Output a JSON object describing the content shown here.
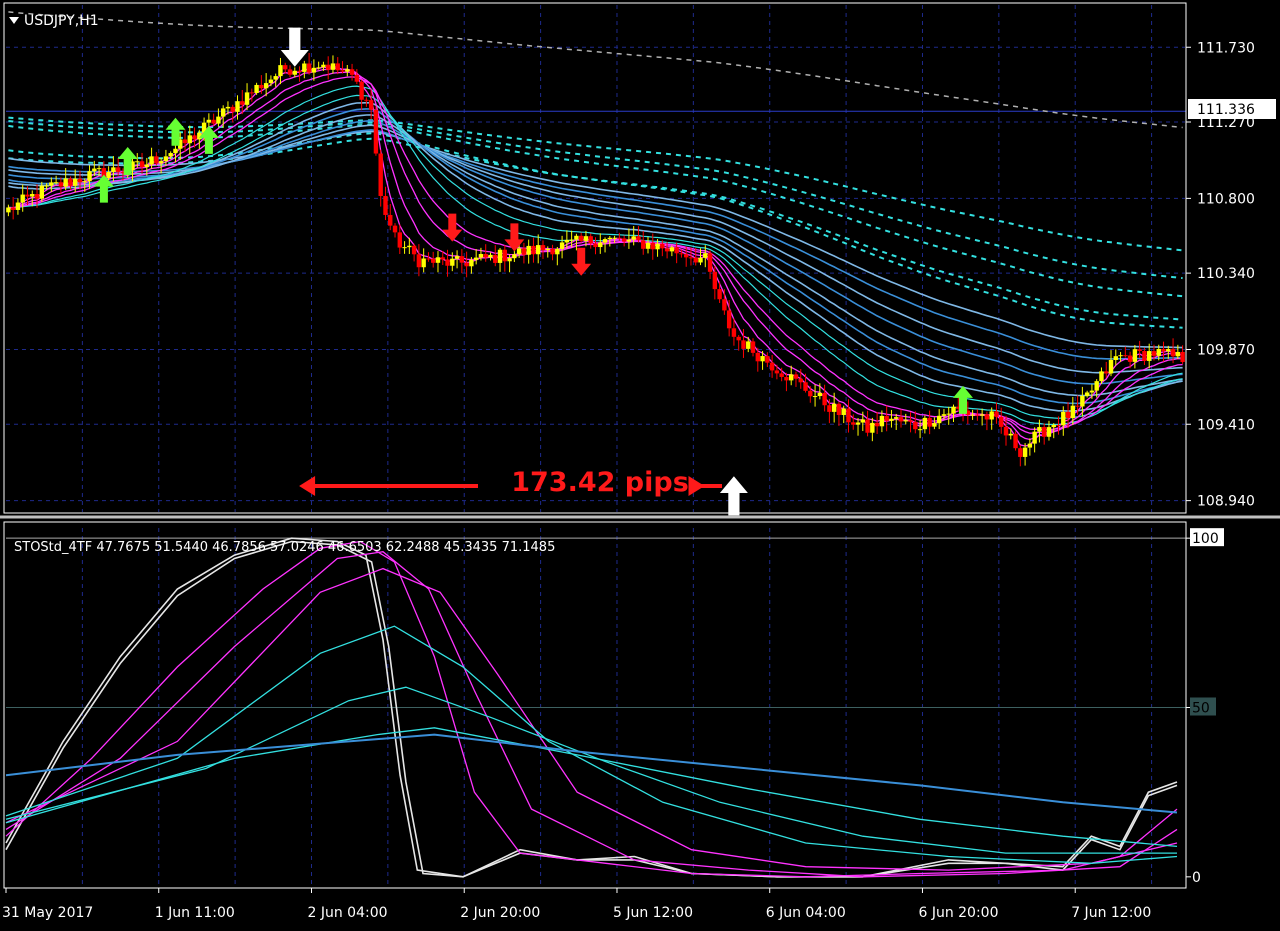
{
  "window": {
    "title": "USDJPY,H1"
  },
  "price_panel": {
    "current_price_label": "111.336",
    "annotation": {
      "text": "173.42  pips"
    }
  },
  "indicator_panel": {
    "label": "STOStd_4TF 47.7675 51.5440 46.7856 57.0246 46.6503 62.2488 45.3435 71.1485"
  },
  "colors": {
    "background": "#000000",
    "bull_candle": "#ffff00",
    "bear_candle": "#ff0000",
    "grid": "#1e2a8c",
    "axis": "#ffffff",
    "magenta_ma": "#ff33ff",
    "cyan_ma": "#33e0e0",
    "blue_ma": "#3a8fd8",
    "stoch_white": "#e6e6e6",
    "arrow_up": "#66ff33",
    "arrow_down": "#ff1a1a",
    "annotation": "#ff1a1a"
  },
  "chart_data": [
    {
      "type": "candlestick",
      "symbol": "USDJPY",
      "timeframe": "H1",
      "title": "USDJPY,H1",
      "y_ticks": [
        111.73,
        111.27,
        110.8,
        110.34,
        109.87,
        109.41,
        108.94
      ],
      "y_tick_labels": [
        "111.730",
        "111.270",
        "110.800",
        "110.340",
        "109.870",
        "109.410",
        "108.940"
      ],
      "ylim": [
        108.87,
        111.99
      ],
      "current_price": 111.336,
      "grid": true,
      "x_tick_labels": [
        "31 May 2017",
        "1 Jun 11:00",
        "2 Jun 04:00",
        "2 Jun 20:00",
        "5 Jun 12:00",
        "6 Jun 04:00",
        "6 Jun 20:00",
        "7 Jun 12:00"
      ],
      "close_path": [
        [
          0,
          110.73
        ],
        [
          8,
          110.86
        ],
        [
          18,
          110.95
        ],
        [
          28,
          111.0
        ],
        [
          36,
          111.12
        ],
        [
          44,
          111.3
        ],
        [
          52,
          111.48
        ],
        [
          58,
          111.6
        ],
        [
          66,
          111.63
        ],
        [
          72,
          111.55
        ],
        [
          76,
          111.35
        ],
        [
          78,
          110.8
        ],
        [
          81,
          110.55
        ],
        [
          86,
          110.42
        ],
        [
          94,
          110.4
        ],
        [
          104,
          110.45
        ],
        [
          114,
          110.5
        ],
        [
          124,
          110.55
        ],
        [
          134,
          110.52
        ],
        [
          142,
          110.46
        ],
        [
          146,
          110.42
        ],
        [
          149,
          110.15
        ],
        [
          152,
          109.95
        ],
        [
          158,
          109.82
        ],
        [
          166,
          109.65
        ],
        [
          174,
          109.48
        ],
        [
          180,
          109.38
        ],
        [
          184,
          109.45
        ],
        [
          190,
          109.4
        ],
        [
          198,
          109.5
        ],
        [
          206,
          109.45
        ],
        [
          212,
          109.25
        ],
        [
          218,
          109.4
        ],
        [
          224,
          109.5
        ],
        [
          232,
          109.82
        ],
        [
          240,
          109.85
        ],
        [
          245,
          109.82
        ]
      ],
      "signals": [
        {
          "type": "buy",
          "color": "green",
          "bar": 20,
          "price": 110.86
        },
        {
          "type": "buy",
          "color": "green",
          "bar": 25,
          "price": 111.03
        },
        {
          "type": "buy",
          "color": "green",
          "bar": 35,
          "price": 111.21
        },
        {
          "type": "buy",
          "color": "green",
          "bar": 42,
          "price": 111.16
        },
        {
          "type": "sell",
          "color": "white",
          "bar": 60,
          "price": 111.73
        },
        {
          "type": "sell",
          "color": "red",
          "bar": 93,
          "price": 110.62
        },
        {
          "type": "sell",
          "color": "red",
          "bar": 106,
          "price": 110.56
        },
        {
          "type": "sell",
          "color": "red",
          "bar": 120,
          "price": 110.41
        },
        {
          "type": "buy",
          "color": "white",
          "bar": 152,
          "price": 108.97
        },
        {
          "type": "buy",
          "color": "green",
          "bar": 200,
          "price": 109.56
        }
      ],
      "annotation": {
        "text": "173.42  pips",
        "from_bar": 63,
        "to_bar": 145,
        "price": 109.03
      }
    },
    {
      "type": "line",
      "title": "STOStd_4TF",
      "values_label": [
        47.7675,
        51.544,
        46.7856,
        57.0246,
        46.6503,
        62.2488,
        45.3435,
        71.1485
      ],
      "ylim": [
        -3,
        103
      ],
      "y_ticks": [
        100,
        50,
        0
      ],
      "y_tick_labels": [
        "100",
        "50",
        "0"
      ],
      "levels": [
        100,
        50
      ],
      "series": [
        {
          "color": "white",
          "points": [
            [
              0,
              10
            ],
            [
              10,
              40
            ],
            [
              20,
              65
            ],
            [
              30,
              85
            ],
            [
              40,
              95
            ],
            [
              50,
              100
            ],
            [
              58,
              99
            ],
            [
              63,
              95
            ],
            [
              66,
              70
            ],
            [
              69,
              30
            ],
            [
              72,
              2
            ],
            [
              80,
              0
            ],
            [
              90,
              8
            ],
            [
              100,
              5
            ],
            [
              110,
              6
            ],
            [
              120,
              1
            ],
            [
              135,
              0
            ],
            [
              150,
              0
            ],
            [
              165,
              5
            ],
            [
              175,
              4
            ],
            [
              185,
              3
            ],
            [
              190,
              12
            ],
            [
              195,
              9
            ],
            [
              200,
              25
            ],
            [
              205,
              28
            ]
          ]
        },
        {
          "color": "white",
          "points": [
            [
              0,
              8
            ],
            [
              10,
              38
            ],
            [
              20,
              63
            ],
            [
              30,
              83
            ],
            [
              40,
              94
            ],
            [
              50,
              99
            ],
            [
              58,
              98
            ],
            [
              64,
              93
            ],
            [
              67,
              68
            ],
            [
              70,
              28
            ],
            [
              73,
              1
            ],
            [
              80,
              0
            ],
            [
              90,
              7
            ],
            [
              100,
              5
            ],
            [
              110,
              5
            ],
            [
              120,
              1
            ],
            [
              135,
              0
            ],
            [
              150,
              0
            ],
            [
              165,
              4
            ],
            [
              175,
              4
            ],
            [
              185,
              2
            ],
            [
              190,
              11
            ],
            [
              195,
              8
            ],
            [
              200,
              24
            ],
            [
              205,
              27
            ]
          ]
        },
        {
          "color": "magenta",
          "points": [
            [
              0,
              12
            ],
            [
              15,
              35
            ],
            [
              30,
              62
            ],
            [
              45,
              85
            ],
            [
              55,
              97
            ],
            [
              62,
              99
            ],
            [
              68,
              93
            ],
            [
              75,
              65
            ],
            [
              82,
              25
            ],
            [
              90,
              7
            ],
            [
              105,
              4
            ],
            [
              120,
              1
            ],
            [
              140,
              0
            ],
            [
              160,
              1
            ],
            [
              185,
              2
            ],
            [
              195,
              6
            ],
            [
              205,
              20
            ]
          ]
        },
        {
          "color": "magenta",
          "points": [
            [
              0,
              14
            ],
            [
              20,
              35
            ],
            [
              40,
              68
            ],
            [
              58,
              94
            ],
            [
              66,
              96
            ],
            [
              74,
              85
            ],
            [
              82,
              55
            ],
            [
              92,
              20
            ],
            [
              110,
              5
            ],
            [
              130,
              2
            ],
            [
              150,
              0
            ],
            [
              175,
              1
            ],
            [
              195,
              3
            ],
            [
              205,
              14
            ]
          ]
        },
        {
          "color": "magenta",
          "points": [
            [
              0,
              16
            ],
            [
              30,
              40
            ],
            [
              55,
              84
            ],
            [
              66,
              91
            ],
            [
              76,
              84
            ],
            [
              86,
              60
            ],
            [
              100,
              25
            ],
            [
              120,
              8
            ],
            [
              140,
              3
            ],
            [
              165,
              2
            ],
            [
              190,
              4
            ],
            [
              205,
              10
            ]
          ]
        },
        {
          "color": "cyan",
          "points": [
            [
              0,
              18
            ],
            [
              30,
              35
            ],
            [
              55,
              66
            ],
            [
              68,
              74
            ],
            [
              80,
              62
            ],
            [
              95,
              40
            ],
            [
              115,
              22
            ],
            [
              140,
              10
            ],
            [
              165,
              6
            ],
            [
              190,
              4
            ],
            [
              205,
              6
            ]
          ]
        },
        {
          "color": "cyan",
          "points": [
            [
              0,
              17
            ],
            [
              35,
              32
            ],
            [
              60,
              52
            ],
            [
              70,
              56
            ],
            [
              85,
              47
            ],
            [
              105,
              34
            ],
            [
              125,
              22
            ],
            [
              150,
              12
            ],
            [
              175,
              7
            ],
            [
              205,
              7
            ]
          ]
        },
        {
          "color": "cyan",
          "points": [
            [
              0,
              16
            ],
            [
              40,
              35
            ],
            [
              65,
              42
            ],
            [
              75,
              44
            ],
            [
              100,
              36
            ],
            [
              130,
              26
            ],
            [
              160,
              17
            ],
            [
              185,
              12
            ],
            [
              205,
              9
            ]
          ]
        },
        {
          "color": "blue",
          "points": [
            [
              0,
              30
            ],
            [
              30,
              36
            ],
            [
              60,
              40
            ],
            [
              75,
              42
            ],
            [
              100,
              37
            ],
            [
              130,
              32
            ],
            [
              160,
              27
            ],
            [
              185,
              22
            ],
            [
              205,
              19
            ]
          ]
        }
      ]
    }
  ]
}
